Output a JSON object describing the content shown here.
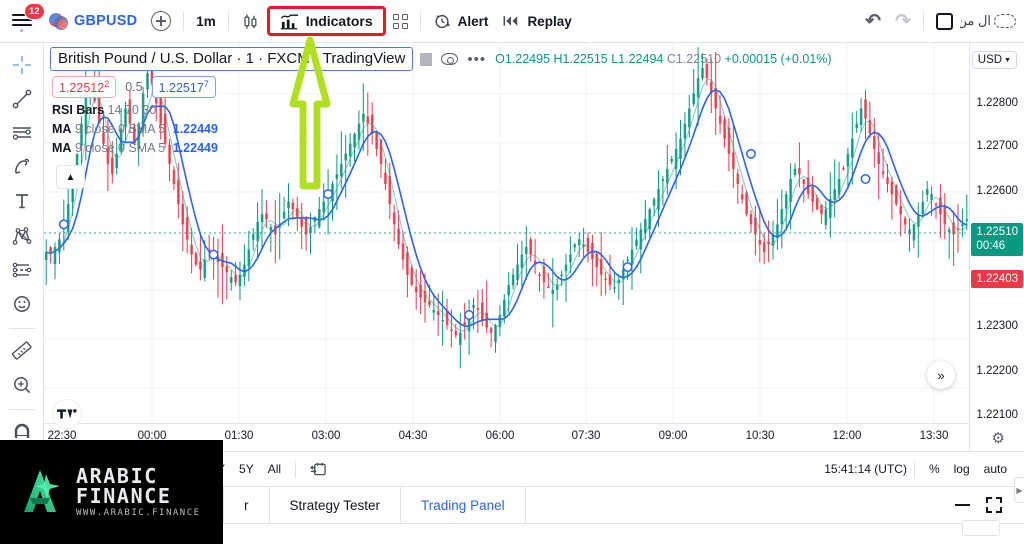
{
  "toolbar": {
    "notifications_badge": "12",
    "symbol": "GBPUSD",
    "add_symbol_label": "+",
    "timeframe": "1m",
    "candle_style_label": "candles-style",
    "indicators_label": "Indicators",
    "templates_label": "templates-grid",
    "alert_label": "Alert",
    "replay_label": "Replay",
    "undo_label": "undo",
    "redo_label": "redo",
    "layout_label": "layout",
    "arabic_text": "ال من",
    "highlight_color": "#e8172a"
  },
  "left_tools": [
    {
      "name": "cross-cursor-tool"
    },
    {
      "name": "trend-line-tool"
    },
    {
      "name": "horizontal-lines-tool"
    },
    {
      "name": "brush-tool"
    },
    {
      "name": "text-tool"
    },
    {
      "name": "pattern-tool"
    },
    {
      "name": "forecast-tool"
    },
    {
      "name": "emoji-tool"
    },
    {
      "name": "measure-ruler-tool"
    },
    {
      "name": "zoom-tool"
    },
    {
      "name": "magnet-tool"
    }
  ],
  "legend": {
    "title": "British Pound / U.S. Dollar · 1 · FXCM · TradingView",
    "ohlc": {
      "open": "O1.22495",
      "high": "H1.22515",
      "low": "L1.22494",
      "close": "C1.22510",
      "change": "+0.00015 (+0.01%)"
    },
    "badge_sell": "1.22512",
    "badge_sell_sup": "2",
    "spread": "0.5",
    "badge_buy": "1.22517",
    "badge_buy_sup": "7",
    "indicators": [
      {
        "name": "RSI Bars",
        "params": "14 70 30",
        "value": ""
      },
      {
        "name": "MA",
        "params": "9 close 0 SMA 5",
        "value": "1.22449"
      },
      {
        "name": "MA",
        "params": "9 close 0 SMA 5",
        "value": "1.22449"
      }
    ]
  },
  "price_scale": {
    "currency_label": "USD",
    "ticks": [
      "1.22800",
      "1.22700",
      "1.22600",
      "1.22300",
      "1.22200",
      "1.22100"
    ],
    "current_price": "1.22510",
    "current_countdown": "00:46",
    "low_price": "1.22403",
    "current_color": "#089981",
    "low_color": "#f23645"
  },
  "time_axis": {
    "labels": [
      "22:30",
      "00:00",
      "01:30",
      "03:00",
      "04:30",
      "06:00",
      "07:30",
      "09:00",
      "10:30",
      "12:00",
      "13:30"
    ]
  },
  "bottom_bar": {
    "ranges": [
      "Y",
      "5Y",
      "All"
    ],
    "calendar_label": "date-range",
    "clock": "15:41:14 (UTC)",
    "percent_label": "%",
    "log_label": "log",
    "auto_label": "auto"
  },
  "tabs": {
    "items": [
      {
        "label": "r",
        "active": false
      },
      {
        "label": "Strategy Tester",
        "active": false
      },
      {
        "label": "Trading Panel",
        "active": true
      }
    ],
    "minimize_label": "minimize",
    "expand_label": "expand"
  },
  "watermark": {
    "main": "ARABIC FINANCE",
    "sub": "WWW.ARABIC.FINANCE",
    "logo_color": "#2ecc8f"
  },
  "annotation": {
    "arrow_color": "#b0e020",
    "arrow_name": "up-arrow-annotation"
  },
  "chart_data": {
    "type": "line",
    "title": "British Pound / U.S. Dollar · 1 · FXCM · TradingView",
    "xlabel": "",
    "ylabel": "USD",
    "ylim": [
      1.2205,
      1.2286
    ],
    "grid": true,
    "legend_position": "top-left",
    "x_tick_labels": [
      "22:30",
      "00:00",
      "01:30",
      "03:00",
      "04:30",
      "06:00",
      "07:30",
      "09:00",
      "10:30",
      "12:00",
      "13:30"
    ],
    "y_tick_labels": [
      "1.22800",
      "1.22700",
      "1.22600",
      "1.22300",
      "1.22200",
      "1.22100"
    ],
    "series": [
      {
        "name": "Close (candlesticks)",
        "values": [
          1.22445,
          1.2244,
          1.22455,
          1.2247,
          1.225,
          1.2254,
          1.2259,
          1.2264,
          1.227,
          1.2276,
          1.2279,
          1.22745,
          1.227,
          1.2266,
          1.2262,
          1.226,
          1.2264,
          1.2269,
          1.2273,
          1.227,
          1.2266,
          1.227,
          1.2276,
          1.228,
          1.2278,
          1.2274,
          1.227,
          1.2266,
          1.2262,
          1.2258,
          1.2254,
          1.225,
          1.2247,
          1.2244,
          1.2242,
          1.2241,
          1.2243,
          1.2245,
          1.2244,
          1.22425,
          1.22415,
          1.22405,
          1.22395,
          1.22385,
          1.224,
          1.2242,
          1.2245,
          1.2248,
          1.22505,
          1.2252,
          1.2251,
          1.22495,
          1.2248,
          1.225,
          1.22525,
          1.22545,
          1.2253,
          1.22515,
          1.22495,
          1.2248,
          1.22495,
          1.22515,
          1.2253,
          1.22545,
          1.2256,
          1.2258,
          1.226,
          1.2262,
          1.2264,
          1.2266,
          1.2268,
          1.227,
          1.2272,
          1.227,
          1.2268,
          1.2265,
          1.2262,
          1.2258,
          1.2254,
          1.225,
          1.2246,
          1.2243,
          1.224,
          1.2238,
          1.22365,
          1.22355,
          1.22345,
          1.2234,
          1.2233,
          1.2232,
          1.2231,
          1.223,
          1.2229,
          1.2228,
          1.22285,
          1.223,
          1.2232,
          1.2234,
          1.2233,
          1.2231,
          1.22295,
          1.22285,
          1.223,
          1.2232,
          1.2235,
          1.2238,
          1.224,
          1.2242,
          1.2244,
          1.22455,
          1.2244,
          1.2242,
          1.224,
          1.22385,
          1.22375,
          1.2237,
          1.2238,
          1.224,
          1.2242,
          1.2244,
          1.2246,
          1.2247,
          1.2246,
          1.22445,
          1.2243,
          1.22415,
          1.224,
          1.2239,
          1.2238,
          1.22375,
          1.2239,
          1.2241,
          1.2243,
          1.2245,
          1.2247,
          1.2249,
          1.2251,
          1.2253,
          1.2255,
          1.2257,
          1.2259,
          1.2261,
          1.2263,
          1.2265,
          1.2267,
          1.227,
          1.2273,
          1.2276,
          1.2279,
          1.2281,
          1.2279,
          1.2276,
          1.2273,
          1.227,
          1.2267,
          1.2264,
          1.2261,
          1.2258,
          1.2255,
          1.2252,
          1.225,
          1.2248,
          1.2246,
          1.22445,
          1.2246,
          1.2248,
          1.225,
          1.2253,
          1.2256,
          1.2259,
          1.2261,
          1.226,
          1.2258,
          1.2256,
          1.22545,
          1.2253,
          1.2252,
          1.2253,
          1.2255,
          1.2257,
          1.2259,
          1.2261,
          1.2264,
          1.2267,
          1.227,
          1.2273,
          1.2271,
          1.2268,
          1.2265,
          1.2262,
          1.226,
          1.2258,
          1.2256,
          1.2254,
          1.2252,
          1.225,
          1.2249,
          1.225,
          1.2252,
          1.22545,
          1.2257,
          1.2256,
          1.2254,
          1.2252,
          1.225,
          1.2249,
          1.2248,
          1.2249,
          1.225,
          1.2251
        ]
      },
      {
        "name": "MA 9 close 0 SMA 5",
        "color": "#2962ff",
        "last_value": 1.22449
      }
    ],
    "current_price": 1.2251,
    "markers": [
      {
        "x_index": 4,
        "price": 1.225
      },
      {
        "x_index": 38,
        "price": 1.2244
      },
      {
        "x_index": 64,
        "price": 1.2256
      },
      {
        "x_index": 96,
        "price": 1.2232
      },
      {
        "x_index": 132,
        "price": 1.22415
      },
      {
        "x_index": 160,
        "price": 1.2264
      },
      {
        "x_index": 186,
        "price": 1.2259
      }
    ]
  }
}
